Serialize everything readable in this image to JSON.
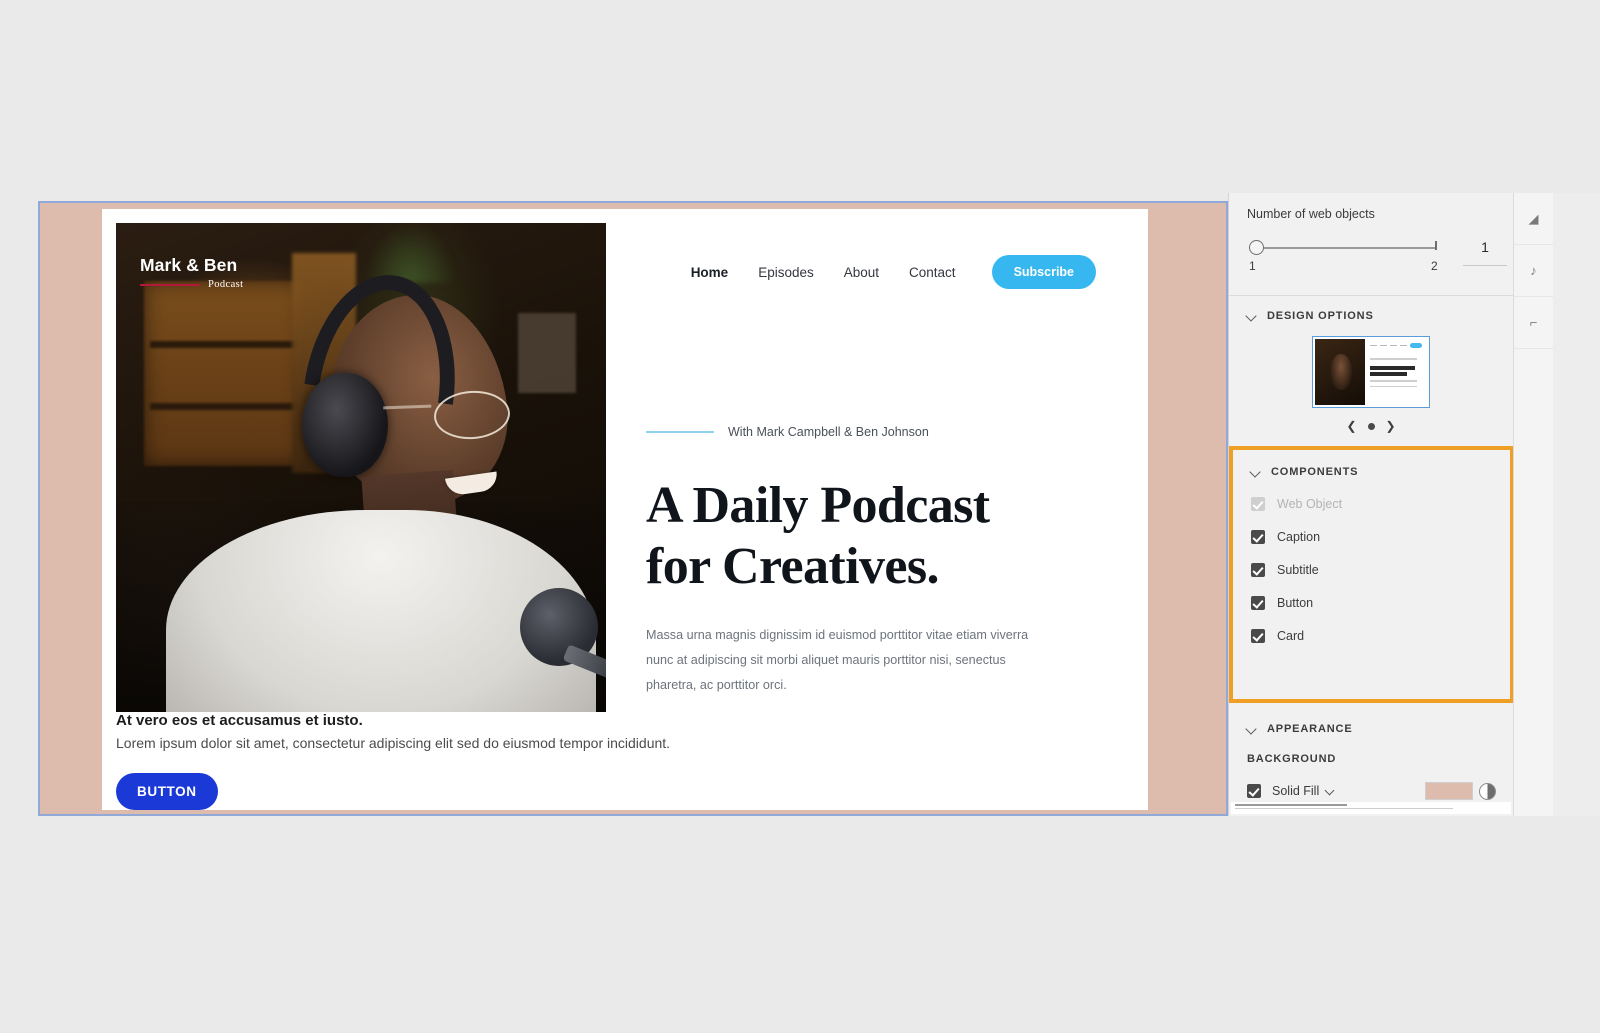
{
  "canvas": {
    "web_object": {
      "logo": {
        "title": "Mark & Ben",
        "subtitle": "Podcast"
      },
      "nav": {
        "links": [
          {
            "label": "Home",
            "active": true
          },
          {
            "label": "Episodes",
            "active": false
          },
          {
            "label": "About",
            "active": false
          },
          {
            "label": "Contact",
            "active": false
          }
        ],
        "cta_label": "Subscribe"
      },
      "eyebrow": "With Mark Campbell & Ben Johnson",
      "headline_line1": "A Daily Podcast",
      "headline_line2": "for Creatives.",
      "body": "Massa urna magnis dignissim id euismod porttitor vitae etiam viverra nunc at adipiscing sit morbi aliquet mauris porttitor nisi, senectus pharetra, ac porttitor orci."
    },
    "card": {
      "caption": "At vero eos et accusamus et iusto.",
      "subtitle": "Lorem ipsum dolor sit amet, consectetur adipiscing elit sed do eiusmod tempor incididunt.",
      "button_label": "BUTTON"
    },
    "background_color": "#ddbcae",
    "selection_color": "#90a9d8"
  },
  "panel": {
    "web_objects": {
      "label": "Number of web objects",
      "slider_min": "1",
      "slider_max": "2",
      "value": "1"
    },
    "design_options": {
      "title": "DESIGN OPTIONS",
      "carousel": {
        "prev_icon": "chevron-left-icon",
        "dot_icon": "dot-icon",
        "next_icon": "chevron-right-icon"
      }
    },
    "components": {
      "title": "COMPONENTS",
      "highlight_color": "#efa024",
      "items": [
        {
          "label": "Web Object",
          "checked": true,
          "disabled": true
        },
        {
          "label": "Caption",
          "checked": true,
          "disabled": false
        },
        {
          "label": "Subtitle",
          "checked": true,
          "disabled": false
        },
        {
          "label": "Button",
          "checked": true,
          "disabled": false
        },
        {
          "label": "Card",
          "checked": true,
          "disabled": false
        }
      ]
    },
    "appearance": {
      "title": "APPEARANCE",
      "background_label": "BACKGROUND",
      "fill_label": "Solid Fill",
      "fill_checked": true,
      "fill_color": "#ddbcae"
    }
  },
  "tool_strip": {
    "buttons": [
      {
        "icon": "shapes-icon",
        "glyph": "◢"
      },
      {
        "icon": "note-icon",
        "glyph": "♪"
      },
      {
        "icon": "text-icon",
        "glyph": "⌐"
      }
    ]
  }
}
